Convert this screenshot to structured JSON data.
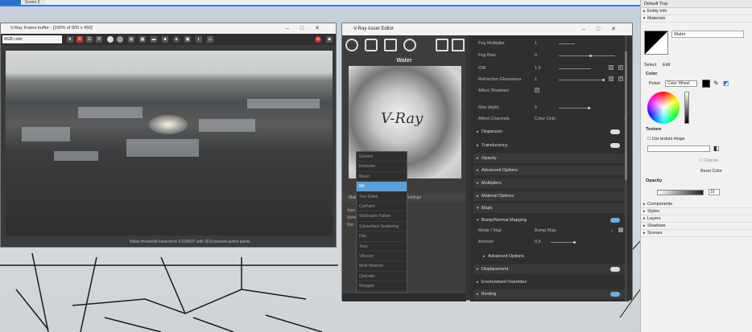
{
  "sketchup": {
    "tab_active": "",
    "tab_other": "Scene 2"
  },
  "tray": {
    "title": "Default Tray",
    "entity_info": "Entity Info",
    "materials": "Materials",
    "material_name": "Water",
    "tab_select": "Select",
    "tab_edit": "Edit",
    "color_label": "Color",
    "picker_label": "Picker:",
    "picker_value": "Color Wheel",
    "texture_label": "Texture",
    "use_texture": "Use texture image",
    "colorize": "Colorize",
    "reset_color": "Reset Color",
    "opacity_label": "Opacity",
    "opacity_value": "10",
    "lower_items": [
      "Components",
      "Styles",
      "Layers",
      "Shadows",
      "Scenes"
    ]
  },
  "vfb": {
    "title": "V-Ray Frame buffer - [100% of 800 x 450]",
    "channel": "RGB color",
    "toolbar": [
      "R",
      "G",
      "B"
    ],
    "status": "Noise threshold lowered to 0.018437 with 39.8 percent active pixels."
  },
  "vae": {
    "title": "V-Ray Asset Editor",
    "preview_title": "Water",
    "preview_text": "V-Ray",
    "left_tab_label": "Materials",
    "left_tab_settings": "Settings",
    "left_list": [
      "Appr",
      "Wate",
      "Wei"
    ],
    "menu": [
      "Generic",
      "Emissive",
      "Blend",
      "Mtl",
      "Two Sided",
      "CarPaint",
      "Stochastic Flakes",
      "Subsurface Scattering",
      "Hair",
      "Toon",
      "VRscan",
      "Multi Material",
      "Override",
      "Wrapper"
    ],
    "menu_highlight_index": 3,
    "params": {
      "fog_multiplier": {
        "label": "Fog Multiplier",
        "value": "1"
      },
      "fog_bias": {
        "label": "Fog Bias",
        "value": "0"
      },
      "ior": {
        "label": "IOR",
        "value": "1.6"
      },
      "refraction_glossiness": {
        "label": "Refraction Glossiness",
        "value": "1"
      },
      "affect_shadows": {
        "label": "Affect Shadows"
      },
      "max_depth": {
        "label": "Max depth",
        "value": "5"
      },
      "affect_channels": {
        "label": "Affect Channels",
        "value": "Color Only"
      },
      "mode_map": {
        "label": "Mode / Map",
        "value": "Bump Map"
      },
      "amount": {
        "label": "Amount",
        "value": "0.5"
      }
    },
    "sections": [
      "Dispersion",
      "Translucency",
      "Opacity",
      "Advanced Options",
      "Multipliers",
      "Material Options",
      "Maps",
      "Bump/Normal Mapping",
      "Advanced Options",
      "Displacement",
      "Environment Overrides",
      "Binding"
    ]
  },
  "colors": {
    "accent": "#5aa0d8",
    "vray_dark": "#2f2f2f",
    "sketchup_blue": "#2c6fc8"
  }
}
